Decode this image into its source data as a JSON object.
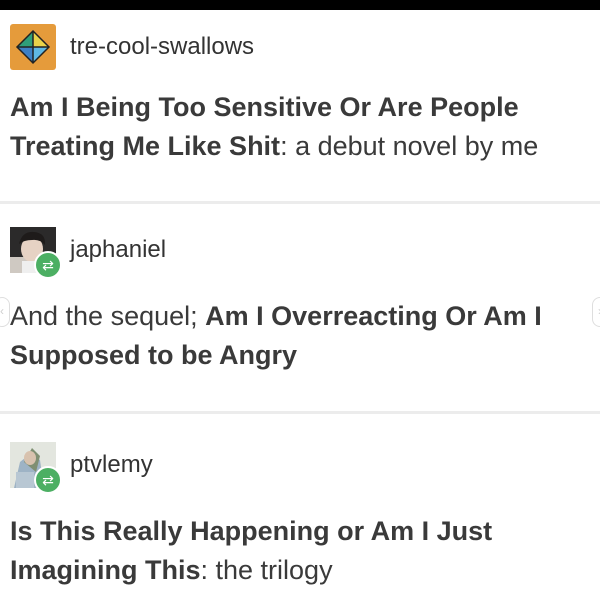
{
  "posts": [
    {
      "username": "tre-cool-swallows",
      "avatar_icon": "diamond-logo-icon",
      "segments": [
        {
          "text": "Am I Being Too Sensitive Or Are People Treating Me Like Shit",
          "bold": true
        },
        {
          "text": ": a debut novel by me",
          "bold": false
        }
      ]
    },
    {
      "username": "japhaniel",
      "avatar_icon": "profile-photo",
      "reblog_icon": "reblog-icon",
      "segments": [
        {
          "text": "And the sequel; ",
          "bold": false
        },
        {
          "text": "Am I Overreacting Or Am I Supposed to be Angry",
          "bold": true
        }
      ]
    },
    {
      "username": "ptvlemy",
      "avatar_icon": "profile-photo",
      "reblog_icon": "reblog-icon",
      "segments": [
        {
          "text": "Is This Really Happening or Am I Just Imagining This",
          "bold": true
        },
        {
          "text": ": the trilogy",
          "bold": false
        }
      ]
    }
  ],
  "colors": {
    "reblog_badge": "#4caf63",
    "avatar_orange": "#e59b3b",
    "text": "#3a3a3a"
  }
}
